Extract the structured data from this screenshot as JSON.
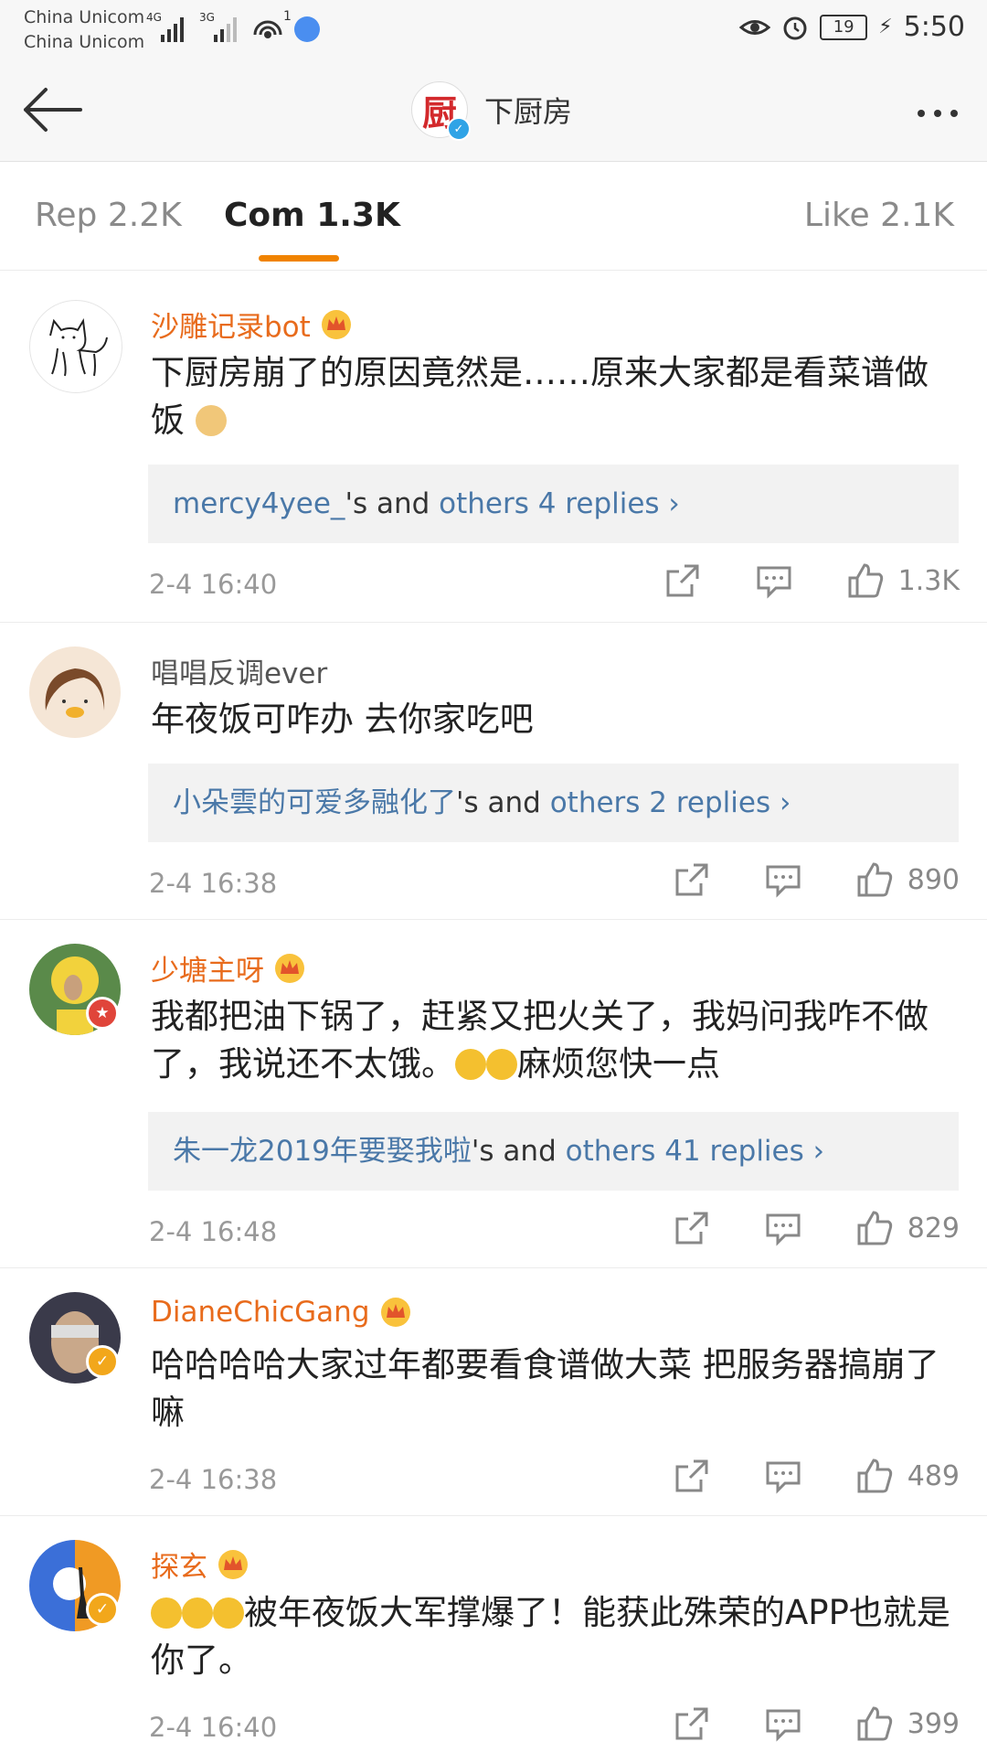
{
  "status_bar": {
    "carrier_1": "China Unicom",
    "carrier_2": "China Unicom",
    "network_1": "4G",
    "network_2": "3G",
    "wifi_sub": "1",
    "battery": "19",
    "time": "5:50"
  },
  "navbar": {
    "logo_char": "厨",
    "title": "下厨房"
  },
  "tabs": {
    "reposts": "Rep 2.2K",
    "comments": "Com 1.3K",
    "likes": "Like 2.1K"
  },
  "colors": {
    "accent": "#f08300",
    "vip_name": "#e86b1c",
    "link_blue": "#4a78a8"
  },
  "comments": [
    {
      "user": "沙雕记录bot",
      "vip": true,
      "text": "下厨房崩了的原因竟然是……原来大家都是看菜谱做饭",
      "emoji_icon": "doge-emoji",
      "replies": {
        "first": "mercy4yee_",
        "mid": "'s and ",
        "rest": "others 4 replies"
      },
      "time": "2-4 16:40",
      "likes": "1.3K"
    },
    {
      "user": "唱唱反调ever",
      "vip": false,
      "text": "年夜饭可咋办 去你家吃吧",
      "replies": {
        "first": "小朵雲的可爱多融化了",
        "mid": "'s and ",
        "rest": "others 2 replies"
      },
      "time": "2-4 16:38",
      "likes": "890"
    },
    {
      "user": "少塘主呀",
      "vip": true,
      "text_a": "我都把油下锅了，赶紧又把火关了，我妈问我咋不做了，我说还不太饿。",
      "text_b": "麻烦您快一点",
      "emoji_icon": "smile-emoji",
      "replies": {
        "first": "朱一龙2019年要娶我啦",
        "mid": "'s and ",
        "rest": "others 41 replies"
      },
      "time": "2-4 16:48",
      "likes": "829"
    },
    {
      "user": "DianeChicGang",
      "vip": true,
      "text": "哈哈哈哈大家过年都要看食谱做大菜 把服务器搞崩了嘛",
      "time": "2-4 16:38",
      "likes": "489"
    },
    {
      "user": "探玄",
      "vip": true,
      "text": "被年夜饭大军撑爆了！能获此殊荣的APP也就是你了。",
      "emoji_icon": "laugh-cry-emoji",
      "time": "2-4 16:40",
      "likes": "399"
    }
  ]
}
